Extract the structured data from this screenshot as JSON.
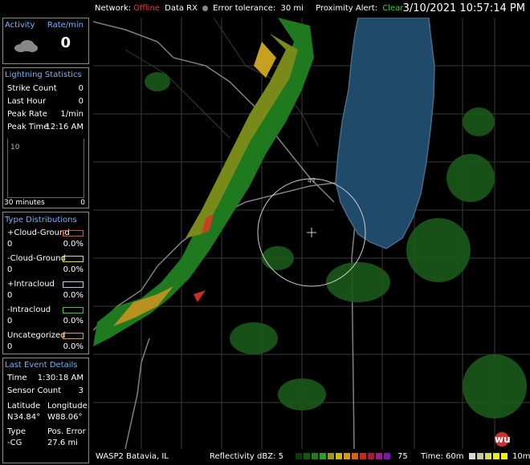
{
  "topbar": {
    "network_label": "Network:",
    "network_status": "Offline",
    "data_rx": "Data RX",
    "error_tolerance_label": "Error tolerance:",
    "error_tolerance_value": "30 mi",
    "proximity_label": "Proximity Alert:",
    "proximity_status": "Clear",
    "datetime": "3/10/2021 10:57:14 PM",
    "colors": {
      "offline": "#ff3030",
      "clear": "#22dd22",
      "dot": "#888888"
    }
  },
  "activity": {
    "title": "Activity",
    "rate_label": "Rate/min",
    "rate_value": "0",
    "icon": "cloud-icon"
  },
  "lightning": {
    "title": "Lightning Statistics",
    "strike_count_label": "Strike Count",
    "strike_count_value": "0",
    "last_hour_label": "Last Hour",
    "last_hour_value": "0",
    "peak_rate_label": "Peak Rate",
    "peak_rate_value": "1/min",
    "peak_time_label": "Peak Time",
    "peak_time_value": "12:16 AM",
    "graph_y_label": "10",
    "graph_x_label": "30 minutes",
    "graph_x_end": "0"
  },
  "type_distributions": {
    "title": "Type Distributions",
    "items": [
      {
        "label": "+Cloud-Ground",
        "count": "0",
        "percent": "0.0%",
        "color": "#e0502a"
      },
      {
        "label": "-Cloud-Ground",
        "count": "0",
        "percent": "0.0%",
        "color": "#e8e040"
      },
      {
        "label": "+Intracloud",
        "count": "0",
        "percent": "0.0%",
        "color": "#b8c8ee"
      },
      {
        "label": "-Intracloud",
        "count": "0",
        "percent": "0.0%",
        "color": "#30d030"
      },
      {
        "label": "Uncategorized",
        "count": "0",
        "percent": "0.0%",
        "color": "#d8a040"
      }
    ]
  },
  "last_event": {
    "title": "Last Event Details",
    "time_label": "Time",
    "time_value": "1:30:18 AM",
    "sensor_count_label": "Sensor Count",
    "sensor_count_value": "3",
    "latitude_label": "Latitude",
    "longitude_label": "Longitude",
    "latitude_value": "N34.84°",
    "longitude_value": "W88.06°",
    "type_label": "Type",
    "pos_error_label": "Pos. Error",
    "type_value": "-CG",
    "pos_error_value": "27.6 mi"
  },
  "map": {
    "range_ring_label": "47",
    "logo": "wu-logo"
  },
  "bottombar": {
    "site": "WASP2  Batavia, IL",
    "reflectivity_label": "Reflectivity dBZ: 5",
    "reflectivity_max": "75",
    "reflectivity_colors": [
      "#0a3a0a",
      "#0f5a0f",
      "#178017",
      "#1fa61f",
      "#9a9a1a",
      "#c8b81a",
      "#d89a1a",
      "#d8601a",
      "#c82a1a",
      "#a81a3a",
      "#a01a8a",
      "#7a1aa8"
    ],
    "time_label": "Time: 60m",
    "time_end": "10m",
    "time_colors": [
      "#d8d8d8",
      "#c8c8a8",
      "#d8d860",
      "#e8e830",
      "#f0f010"
    ]
  }
}
